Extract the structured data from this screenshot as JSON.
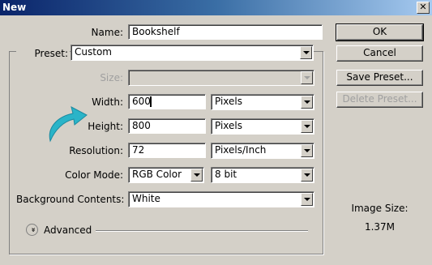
{
  "window": {
    "title": "New",
    "close_glyph": "✕"
  },
  "form": {
    "name_label": "Name:",
    "name_value": "Bookshelf",
    "preset_label": "Preset:",
    "preset_value": "Custom",
    "size_label": "Size:",
    "size_value": "",
    "width_label": "Width:",
    "width_value": "600",
    "width_unit": "Pixels",
    "height_label": "Height:",
    "height_value": "800",
    "height_unit": "Pixels",
    "resolution_label": "Resolution:",
    "resolution_value": "72",
    "resolution_unit": "Pixels/Inch",
    "color_mode_label": "Color Mode:",
    "color_mode_value": "RGB Color",
    "bit_depth_value": "8 bit",
    "background_label": "Background Contents:",
    "background_value": "White",
    "advanced_label": "Advanced",
    "advanced_glyph": "»"
  },
  "buttons": {
    "ok": "OK",
    "cancel": "Cancel",
    "save_preset": "Save Preset...",
    "delete_preset": "Delete Preset..."
  },
  "info": {
    "image_size_label": "Image Size:",
    "image_size_value": "1.37M"
  },
  "colors": {
    "dialog_bg": "#d4d0c8",
    "titlebar": "#0a246a",
    "arrow_annotation": "#2ab4c8"
  }
}
